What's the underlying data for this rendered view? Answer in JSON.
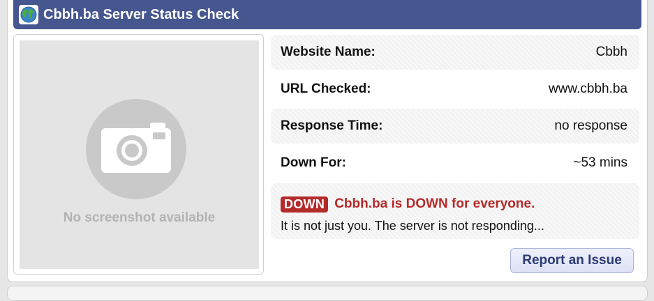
{
  "header": {
    "icon": "globe-icon",
    "title": "Cbbh.ba Server Status Check",
    "bg_color": "#46568f"
  },
  "screenshot": {
    "icon": "camera-icon",
    "placeholder_text": "No screenshot available"
  },
  "details": [
    {
      "label": "Website Name:",
      "value": "Cbbh"
    },
    {
      "label": "URL Checked:",
      "value": "www.cbbh.ba"
    },
    {
      "label": "Response Time:",
      "value": "no response"
    },
    {
      "label": "Down For:",
      "value": "~53 mins"
    }
  ],
  "status": {
    "badge": "DOWN",
    "message": "Cbbh.ba is DOWN for everyone.",
    "subtext": "It is not just you. The server is not responding...",
    "color": "#b42a2a"
  },
  "actions": {
    "report_label": "Report an Issue"
  }
}
